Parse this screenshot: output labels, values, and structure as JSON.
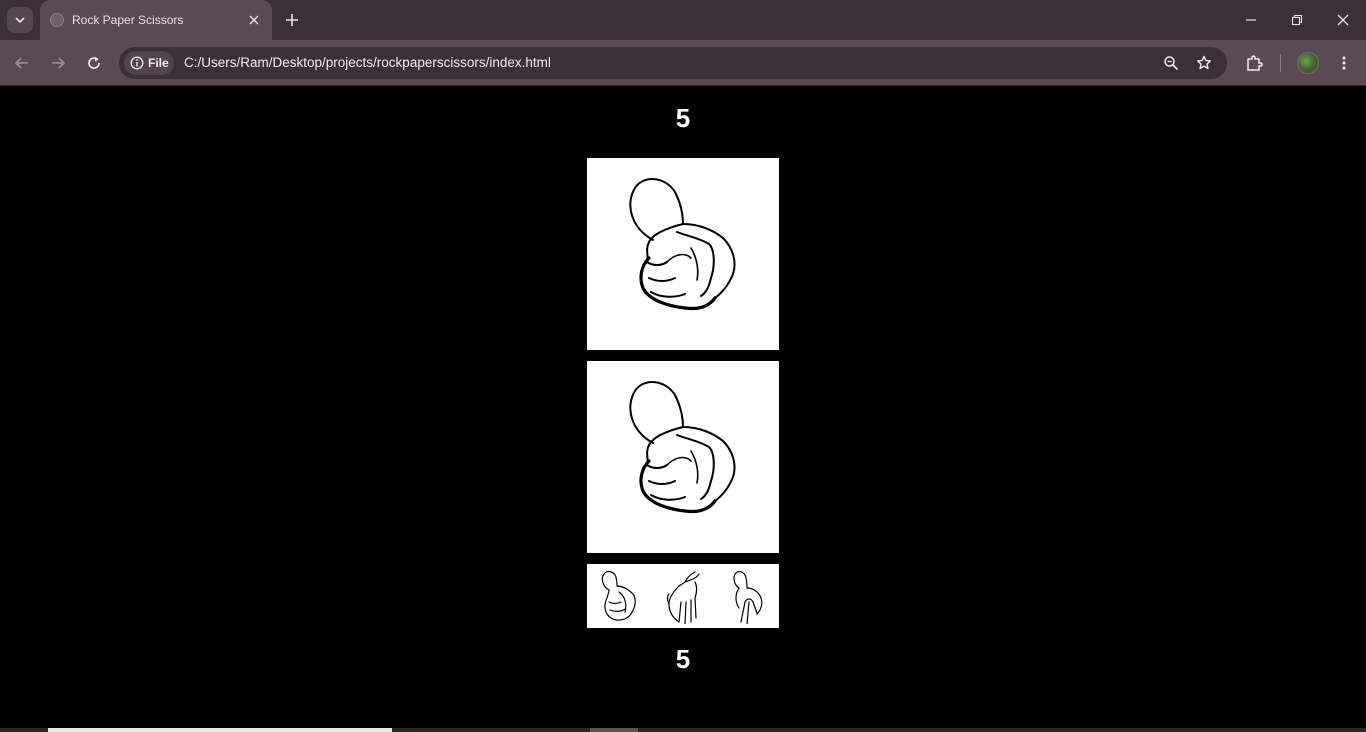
{
  "browser": {
    "tab": {
      "title": "Rock Paper Scissors"
    },
    "address_bar": {
      "chip_label": "File",
      "url": "C:/Users/Ram/Desktop/projects/rockpaperscissors/index.html"
    }
  },
  "game": {
    "computer_score": "5",
    "player_score": "5",
    "computer_choice": "rock",
    "player_choice": "rock",
    "choices": [
      "rock",
      "paper",
      "scissors"
    ]
  }
}
